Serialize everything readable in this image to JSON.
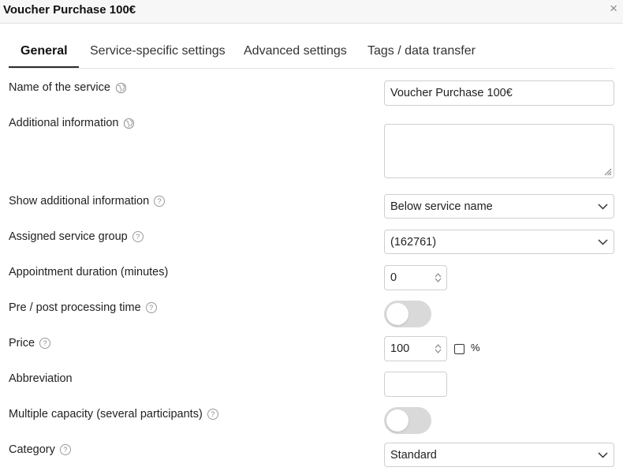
{
  "window": {
    "title": "Voucher Purchase 100€",
    "close_glyph": "×"
  },
  "tabs": [
    {
      "label": "General",
      "active": true
    },
    {
      "label": "Service-specific settings",
      "active": false
    },
    {
      "label": "Advanced settings",
      "active": false
    },
    {
      "label": "Tags / data transfer",
      "active": false
    }
  ],
  "form": {
    "name_of_service": {
      "label": "Name of the service",
      "value": "Voucher Purchase 100€",
      "icon": "globe-icon"
    },
    "additional_information": {
      "label": "Additional information",
      "value": "",
      "icon": "globe-icon"
    },
    "show_additional_information": {
      "label": "Show additional information",
      "value": "Below service name",
      "icon": "help-icon"
    },
    "assigned_service_group": {
      "label": "Assigned service group",
      "value": "(162761)",
      "icon": "help-icon"
    },
    "appointment_duration": {
      "label": "Appointment duration (minutes)",
      "value": "0"
    },
    "pre_post_processing_time": {
      "label": "Pre / post processing time",
      "enabled": false,
      "icon": "help-icon"
    },
    "price": {
      "label": "Price",
      "value": "100",
      "percent_label": "%",
      "percent_checked": false,
      "icon": "help-icon"
    },
    "abbreviation": {
      "label": "Abbreviation",
      "value": ""
    },
    "multiple_capacity": {
      "label": "Multiple capacity (several participants)",
      "enabled": false,
      "icon": "help-icon"
    },
    "category": {
      "label": "Category",
      "value": "Standard",
      "icon": "help-icon"
    }
  },
  "help_glyph": "?",
  "colors": {
    "toggle_off": "#d9d9d9",
    "tab_underline": "#2c2c2c",
    "border": "#cfcfcf"
  }
}
